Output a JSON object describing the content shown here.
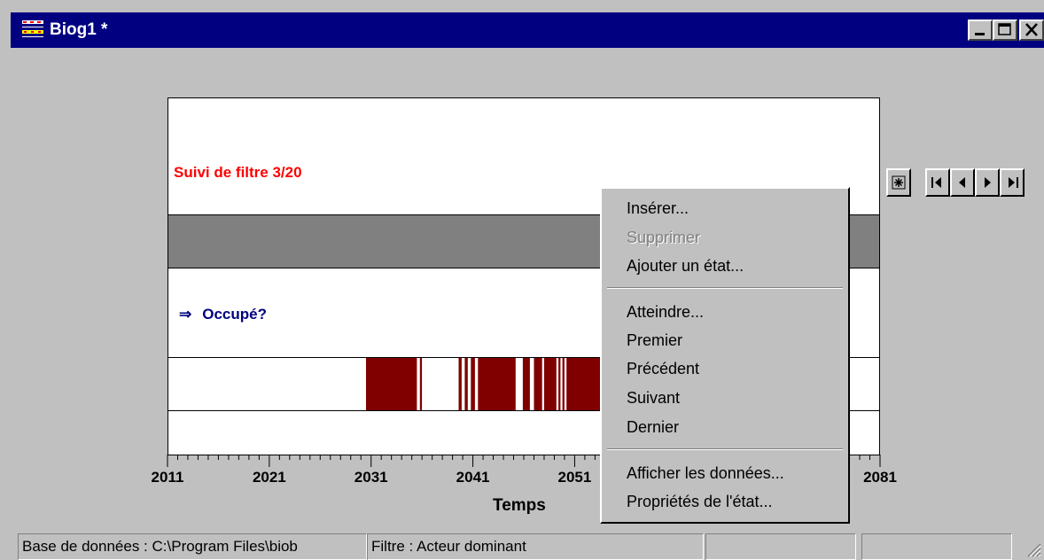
{
  "window": {
    "title": "Biog1 *",
    "buttons": [
      "minimize",
      "maximize",
      "close"
    ]
  },
  "chart": {
    "row_title": "Suivi de filtre 3/20",
    "state_arrow": "⇒",
    "state_label": "Occupé?",
    "axis_title": "Temps",
    "tick_labels": [
      "2011",
      "2021",
      "2031",
      "2041",
      "2051",
      "2081"
    ]
  },
  "chart_data": {
    "type": "bar",
    "title": "Suivi de filtre 3/20",
    "xlabel": "Temps",
    "ylabel": "",
    "xlim": [
      2011,
      2081
    ],
    "state": "Occupé?",
    "occupied_intervals": [
      [
        2030.5,
        2035.5
      ],
      [
        2035.8,
        2036.0
      ],
      [
        2039.6,
        2039.9
      ],
      [
        2040.2,
        2040.5
      ],
      [
        2040.8,
        2041.2
      ],
      [
        2041.5,
        2045.2
      ],
      [
        2045.9,
        2046.6
      ],
      [
        2047.0,
        2047.8
      ],
      [
        2048.0,
        2049.2
      ],
      [
        2049.4,
        2049.6
      ],
      [
        2049.8,
        2050.0
      ],
      [
        2050.2,
        2054.5
      ]
    ],
    "colors": {
      "occupied": "#800000",
      "band": "#808080",
      "title": "#ff0000",
      "state_label": "#000080"
    }
  },
  "navigation": {
    "buttons": [
      "select-icon",
      "first-icon",
      "previous-icon",
      "next-icon",
      "last-icon"
    ]
  },
  "context_menu": {
    "items": [
      {
        "label": "Insérer...",
        "enabled": true
      },
      {
        "label": "Supprimer",
        "enabled": false
      },
      {
        "label": "Ajouter un état...",
        "enabled": true
      },
      {
        "label": "Atteindre...",
        "enabled": true
      },
      {
        "label": "Premier",
        "enabled": true
      },
      {
        "label": "Précédent",
        "enabled": true
      },
      {
        "label": "Suivant",
        "enabled": true
      },
      {
        "label": "Dernier",
        "enabled": true
      },
      {
        "label": "Afficher les données...",
        "enabled": true
      },
      {
        "label": "Propriétés de l'état...",
        "enabled": true
      }
    ]
  },
  "statusbar": {
    "database": "Base de données : C:\\Program Files\\biob",
    "filter": "Filtre : Acteur dominant",
    "panel3": "",
    "panel4": ""
  }
}
